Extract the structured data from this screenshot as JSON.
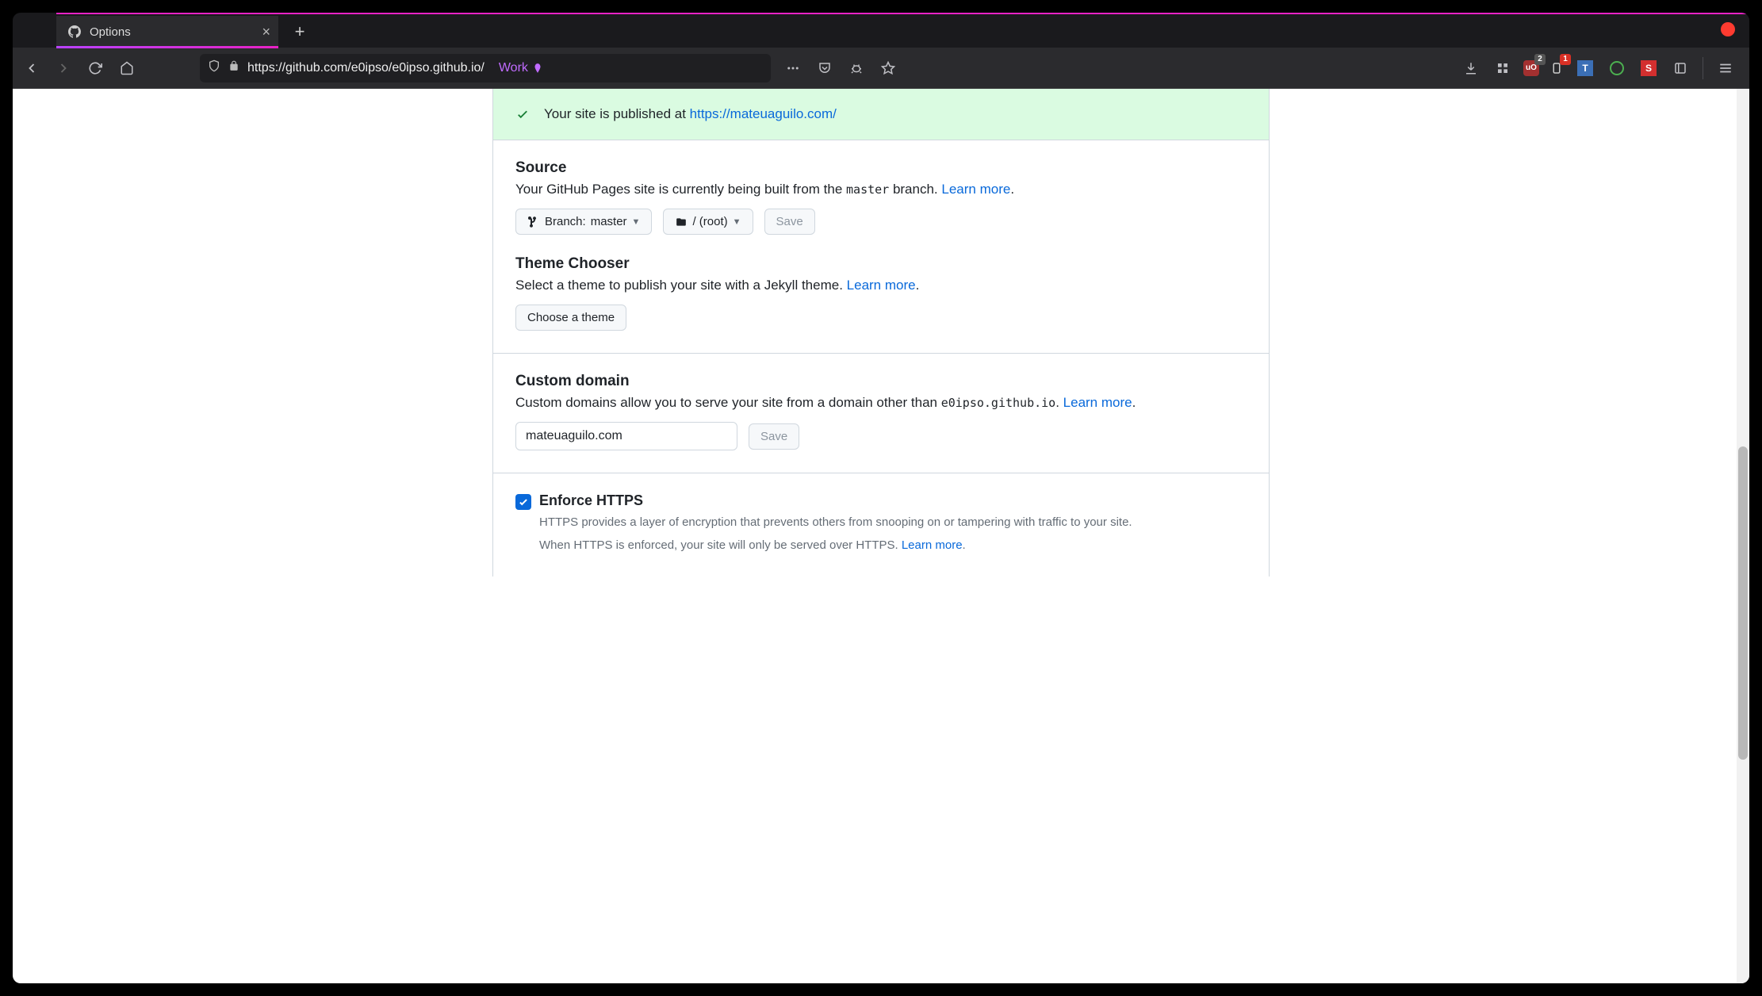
{
  "browser": {
    "tab_title": "Options",
    "url_display": "https://github.com/e0ipso/e0ipso.github.io/",
    "container_label": "Work",
    "ext_badges": {
      "ublock": "2",
      "bell": "1"
    }
  },
  "flash": {
    "prefix": "Your site is published at ",
    "link": "https://mateuaguilo.com/"
  },
  "source": {
    "heading": "Source",
    "desc_pre": "Your GitHub Pages site is currently being built from the ",
    "branch_code": "master",
    "desc_post": " branch. ",
    "learn_more": "Learn more",
    "branch_btn_prefix": "Branch: ",
    "branch_btn_value": "master",
    "folder_btn": "/ (root)",
    "save_btn": "Save"
  },
  "theme": {
    "heading": "Theme Chooser",
    "desc": "Select a theme to publish your site with a Jekyll theme. ",
    "learn_more": "Learn more",
    "choose_btn": "Choose a theme"
  },
  "custom_domain": {
    "heading": "Custom domain",
    "desc_pre": "Custom domains allow you to serve your site from a domain other than ",
    "domain_code": "e0ipso.github.io",
    "desc_post": ". ",
    "learn_more": "Learn more",
    "input_value": "mateuaguilo.com",
    "save_btn": "Save"
  },
  "https": {
    "label": "Enforce HTTPS",
    "line1": "HTTPS provides a layer of encryption that prevents others from snooping on or tampering with traffic to your site.",
    "line2_pre": "When HTTPS is enforced, your site will only be served over HTTPS. ",
    "learn_more": "Learn more"
  }
}
